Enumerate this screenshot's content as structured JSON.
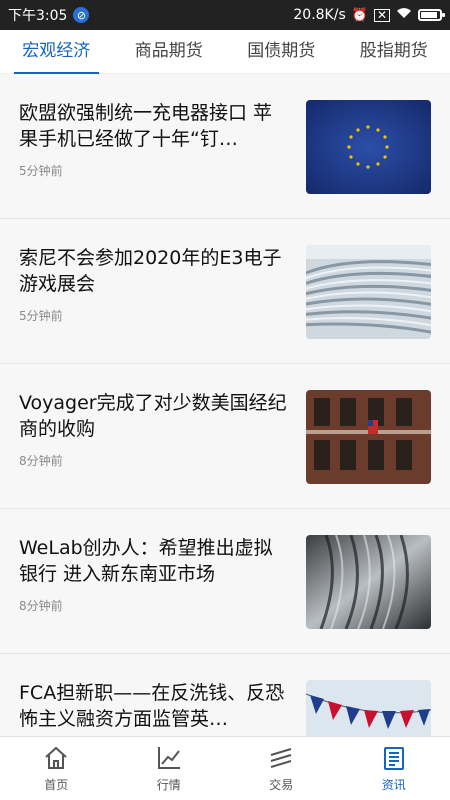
{
  "status_bar": {
    "time": "下午3:05",
    "speed": "20.8K/s"
  },
  "tabs": [
    {
      "label": "宏观经济",
      "active": true
    },
    {
      "label": "商品期货",
      "active": false
    },
    {
      "label": "国债期货",
      "active": false
    },
    {
      "label": "股指期货",
      "active": false
    }
  ],
  "news": [
    {
      "title": "欧盟欲强制统一充电器接口 苹果手机已经做了十年“钉…",
      "time": "5分钟前",
      "image": "eu-flag"
    },
    {
      "title": "索尼不会参加2020年的E3电子游戏展会",
      "time": "5分钟前",
      "image": "newspapers"
    },
    {
      "title": "Voyager完成了对少数美国经纪商的收购",
      "time": "8分钟前",
      "image": "building-flag"
    },
    {
      "title": "WeLab创办人：希望推出虚拟银行 进入新东南亚市场",
      "time": "8分钟前",
      "image": "metal-sculpture"
    },
    {
      "title": "FCA担新职——在反洗钱、反恐怖主义融资方面监管英…",
      "time": "",
      "image": "uk-bunting"
    }
  ],
  "nav": [
    {
      "label": "首页",
      "icon": "home-icon",
      "active": false
    },
    {
      "label": "行情",
      "icon": "chart-icon",
      "active": false
    },
    {
      "label": "交易",
      "icon": "trade-icon",
      "active": false
    },
    {
      "label": "资讯",
      "icon": "news-icon",
      "active": true
    }
  ],
  "colors": {
    "accent": "#1565c0",
    "status_bar": "#222222",
    "background": "#f7f7f7"
  }
}
